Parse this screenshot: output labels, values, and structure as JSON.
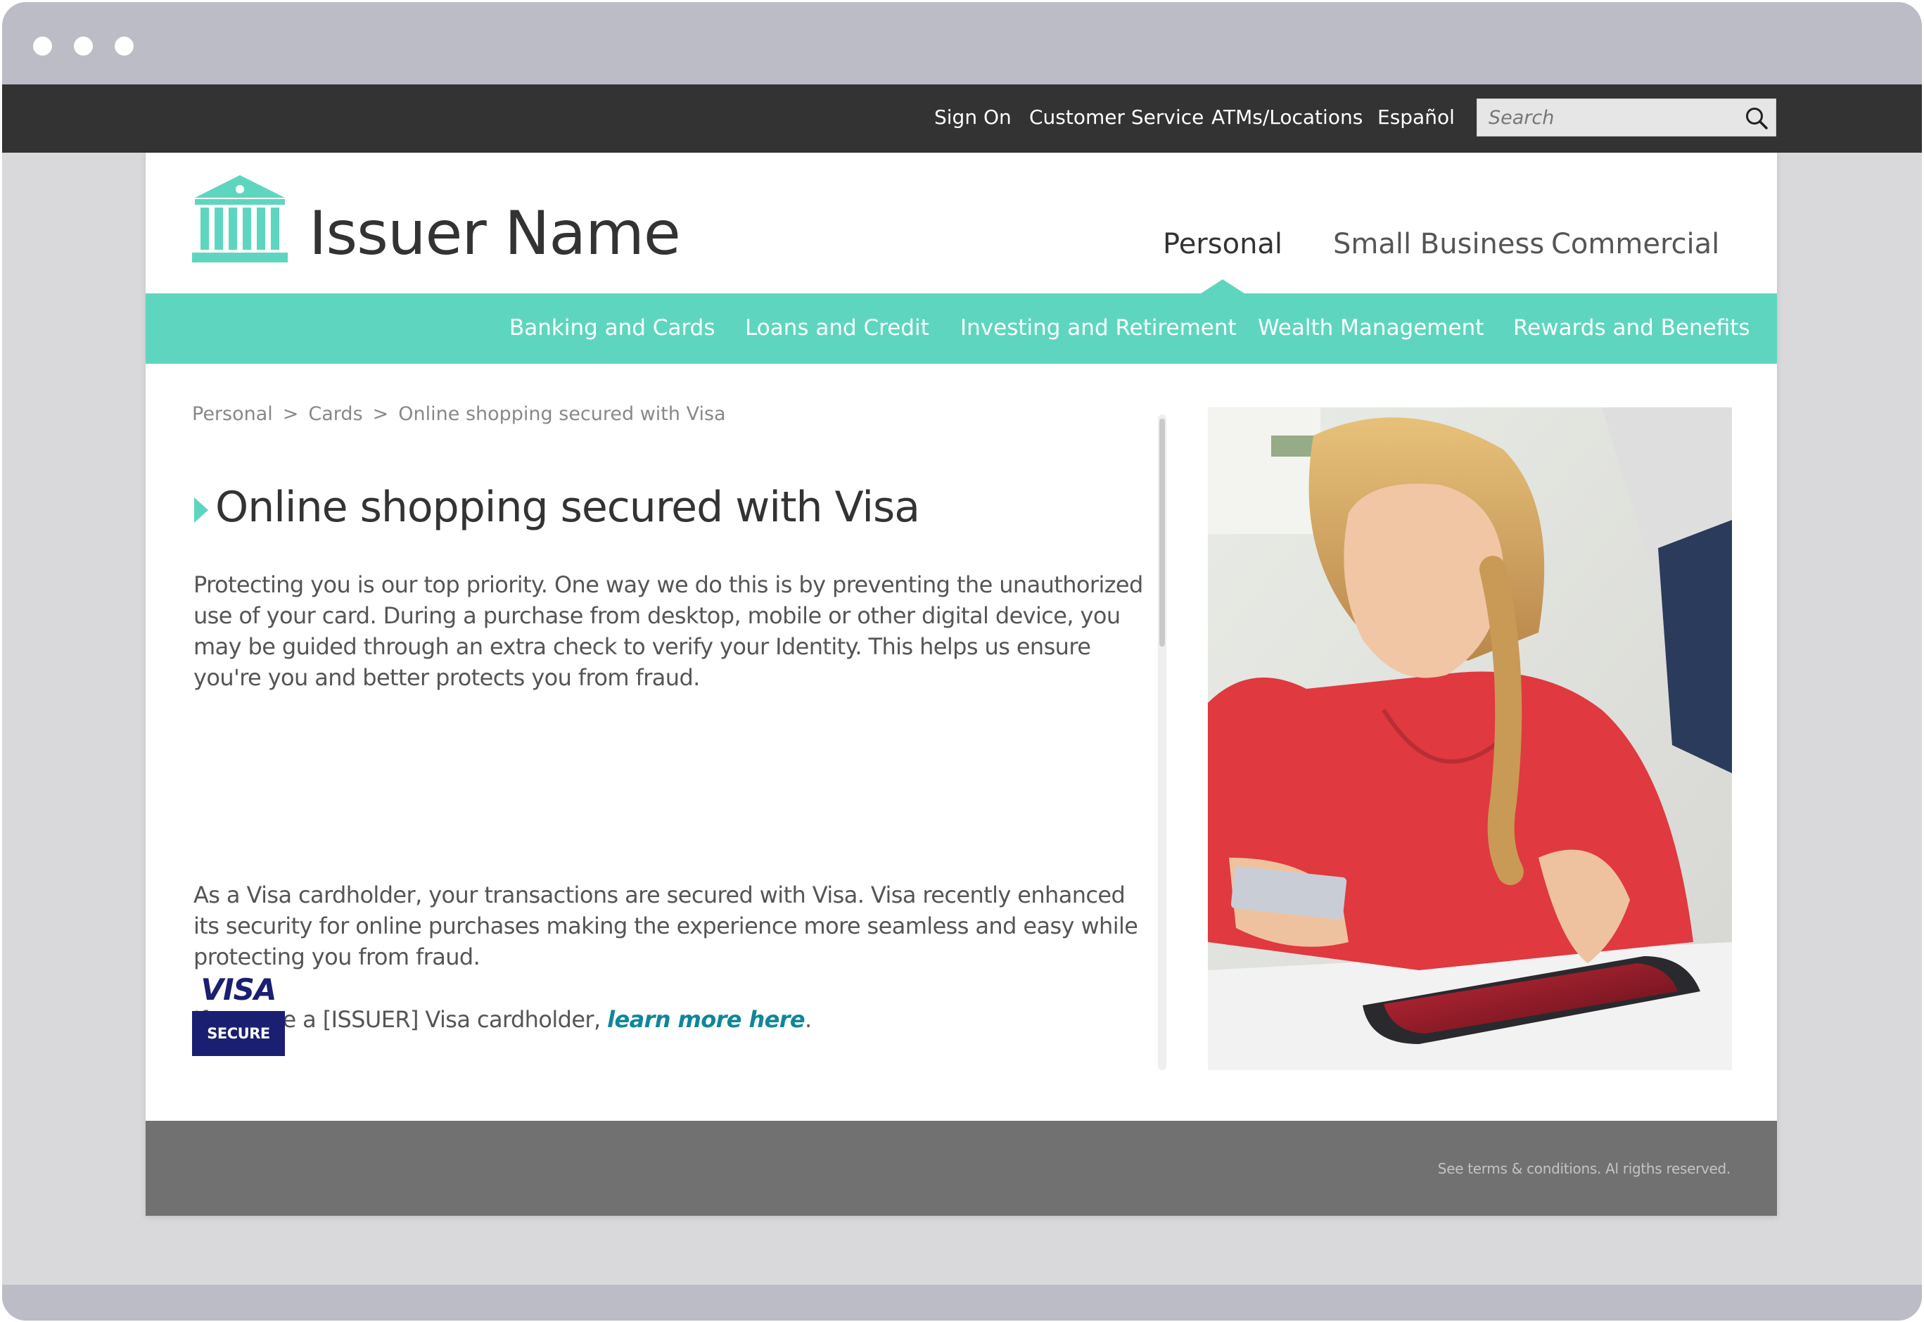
{
  "utility_nav": {
    "links": [
      "Sign On",
      "Customer Service",
      "ATMs/Locations",
      "Español"
    ],
    "search_placeholder": "Search"
  },
  "brand": {
    "name": "Issuer Name",
    "logo_icon": "bank-building-icon",
    "accent_color": "#5ed6bf"
  },
  "segment_tabs": {
    "items": [
      "Personal",
      "Small Business",
      "Commercial"
    ],
    "active": "Personal"
  },
  "main_nav": {
    "items": [
      "Banking and Cards",
      "Loans and Credit",
      "Investing and Retirement",
      "Wealth Management",
      "Rewards and Benefits"
    ]
  },
  "breadcrumb": {
    "items": [
      "Personal",
      "Cards",
      "Online shopping secured with Visa"
    ],
    "separator": ">"
  },
  "article": {
    "title": "Online shopping secured with Visa",
    "paragraph1": "Protecting you is our top priority. One way we do this is by preventing the unauthorized use of your card. During a purchase from desktop, mobile or other digital device, you may be guided through an extra check to verify your Identity. This helps us ensure you're you and better protects you from fraud.",
    "paragraph2": "As a Visa cardholder, your transactions are secured with Visa. Visa recently enhanced its security for online purchases making the experience more seamless and easy while protecting you from fraud.",
    "paragraph3_prefix": "If you are a [ISSUER] Visa cardholder, ",
    "paragraph3_link": "learn more here",
    "paragraph3_suffix": ".",
    "link_color": "#10869a"
  },
  "badge": {
    "brand": "VISA",
    "label": "SECURE",
    "color": "#1a1f71"
  },
  "footer": {
    "text": "See terms & conditions. Al rigths reserved."
  }
}
